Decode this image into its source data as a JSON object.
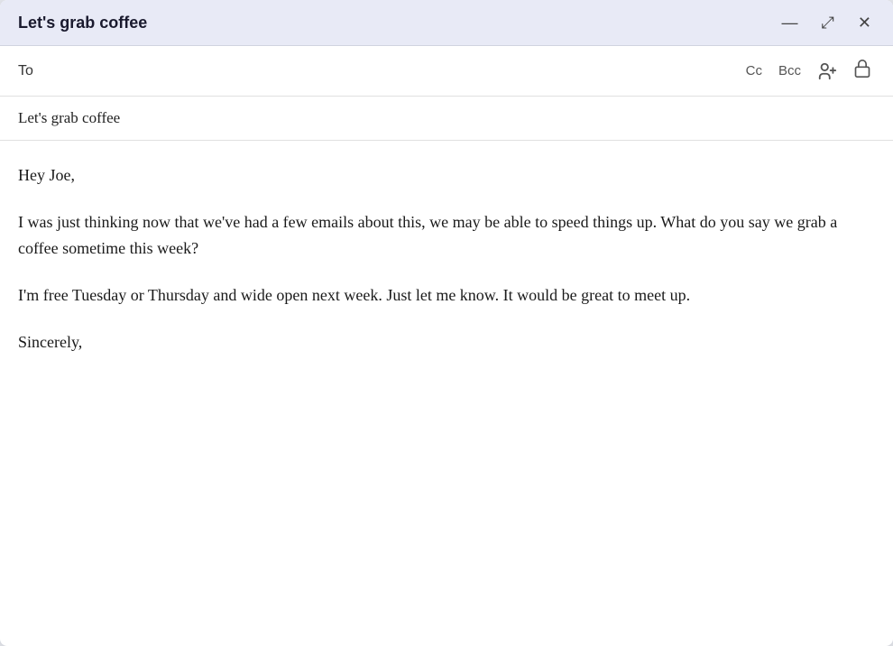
{
  "titleBar": {
    "title": "Let's grab coffee",
    "actions": {
      "minimize": "—",
      "maximize": "⤢",
      "close": "✕"
    }
  },
  "toRow": {
    "label": "To",
    "placeholder": "",
    "cc": "Cc",
    "bcc": "Bcc"
  },
  "subject": "Let's grab coffee",
  "body": {
    "greeting": "Hey Joe,",
    "paragraph1": "I was just thinking now that we've had a few emails about this, we may be able to speed things up. What do you say we grab a coffee sometime this week?",
    "paragraph2": "I'm free Tuesday or Thursday and wide open next week. Just let me know. It would be great to meet up.",
    "closing": "Sincerely,"
  }
}
